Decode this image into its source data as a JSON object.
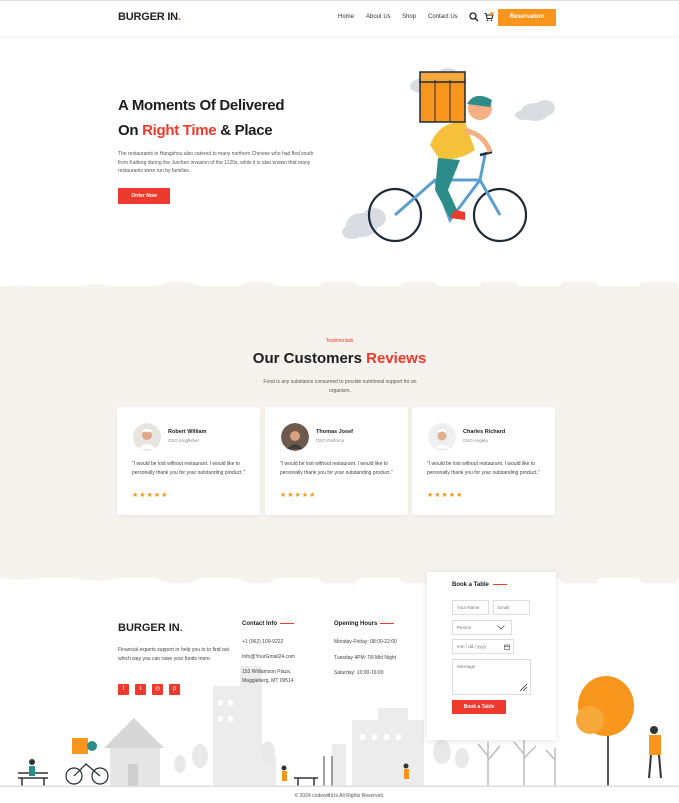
{
  "header": {
    "logo": "BURGER IN",
    "logo_dot": ".",
    "nav": [
      "Home",
      "About Us",
      "Shop",
      "Contact Us"
    ],
    "cart_count": "0",
    "reservation": "Reservation"
  },
  "hero": {
    "title_line1": "A Moments Of Delivered",
    "title_line2_pre": "On ",
    "title_line2_red": "Right Time",
    "title_line2_post": " & Place",
    "description": "The restaurants in Hangzhou also catered to many northern Chinese who had fled south from Kaifeng during the Jurchen invasion of the 1120s, while it is also known that many restaurants were run by families.",
    "order_button": "Order Now"
  },
  "testimonials": {
    "kicker": "Testimonials",
    "title_pre": "Our Customers ",
    "title_red": "Reviews",
    "description": "Food is any substance consumed to provide nutritional support for an organism.",
    "cards": [
      {
        "name": "Robert William",
        "role": "CEO Kingfisher",
        "quote": "\"I would be lost without restaurant. I would like to personally thank you for your outstanding product.\"",
        "stars": "★★★★★"
      },
      {
        "name": "Thomas Josef",
        "role": "CEO Getforce",
        "quote": "\"I would be lost without restaurant. I would like to personally thank you for your outstanding product.\"",
        "stars": "★★★★★"
      },
      {
        "name": "Charles Richard",
        "role": "CEO Angela",
        "quote": "\"I would be lost without restaurant. I would like to personally thank you for your outstanding product.\"",
        "stars": "★★★★★"
      }
    ]
  },
  "footer": {
    "logo": "BURGER IN",
    "logo_dot": ".",
    "description": "Financial experts support or help you to to find out which way you can raise your funds more.",
    "contact_title": "Contact Info",
    "contact": [
      "+1 (062) 109-9222",
      "Info@YourGmail24.com",
      "153 Williamson Plaza, Maggieberg, MT 09514"
    ],
    "hours_title": "Opening Hours",
    "hours": [
      "Monday-Friday: 08:00-22:00",
      "Tuesday 4PM: Till Mid Night",
      "Saturday: 10:00-16:00"
    ],
    "copyright": "© 2024 codewithUs All Rights Reserved."
  },
  "booking": {
    "title": "Book a Table",
    "name_placeholder": "Your Name",
    "email_placeholder": "Email",
    "person_value": "Person",
    "date_placeholder": "mm / dd / yyyy",
    "message_placeholder": "Message",
    "button": "Book a Table"
  },
  "colors": {
    "accent_red": "#ee3a2c",
    "accent_orange": "#f7951d",
    "band_bg": "#f6f3ee"
  }
}
